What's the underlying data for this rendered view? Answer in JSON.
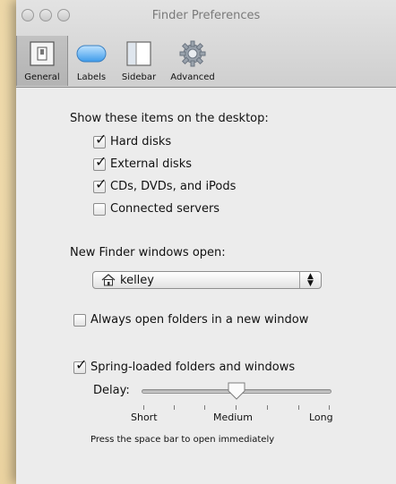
{
  "window": {
    "title": "Finder Preferences"
  },
  "toolbar": {
    "tabs": [
      {
        "label": "General",
        "icon": "light-switch-icon",
        "selected": true
      },
      {
        "label": "Labels",
        "icon": "labels-pill-icon",
        "selected": false
      },
      {
        "label": "Sidebar",
        "icon": "sidebar-icon",
        "selected": false
      },
      {
        "label": "Advanced",
        "icon": "gear-icon",
        "selected": false
      }
    ]
  },
  "general": {
    "desktop_heading": "Show these items on the desktop:",
    "desktop_items": [
      {
        "label": "Hard disks",
        "checked": true
      },
      {
        "label": "External disks",
        "checked": true
      },
      {
        "label": "CDs, DVDs, and iPods",
        "checked": true
      },
      {
        "label": "Connected servers",
        "checked": false
      }
    ],
    "new_window_heading": "New Finder windows open:",
    "new_window_value": "kelley",
    "always_open_label": "Always open folders in a new window",
    "always_open_checked": false,
    "spring_loaded_label": "Spring-loaded folders and windows",
    "spring_loaded_checked": true,
    "delay_label": "Delay:",
    "delay_level": 0.5,
    "slider_labels": {
      "short": "Short",
      "medium": "Medium",
      "long": "Long"
    },
    "hint": "Press the space bar to open immediately"
  },
  "colors": {
    "window_bg": "#ececec",
    "toolbar_top": "#e3e3e3",
    "toolbar_bottom": "#cfcfcf",
    "desk_bg": "#f2dfb2"
  }
}
